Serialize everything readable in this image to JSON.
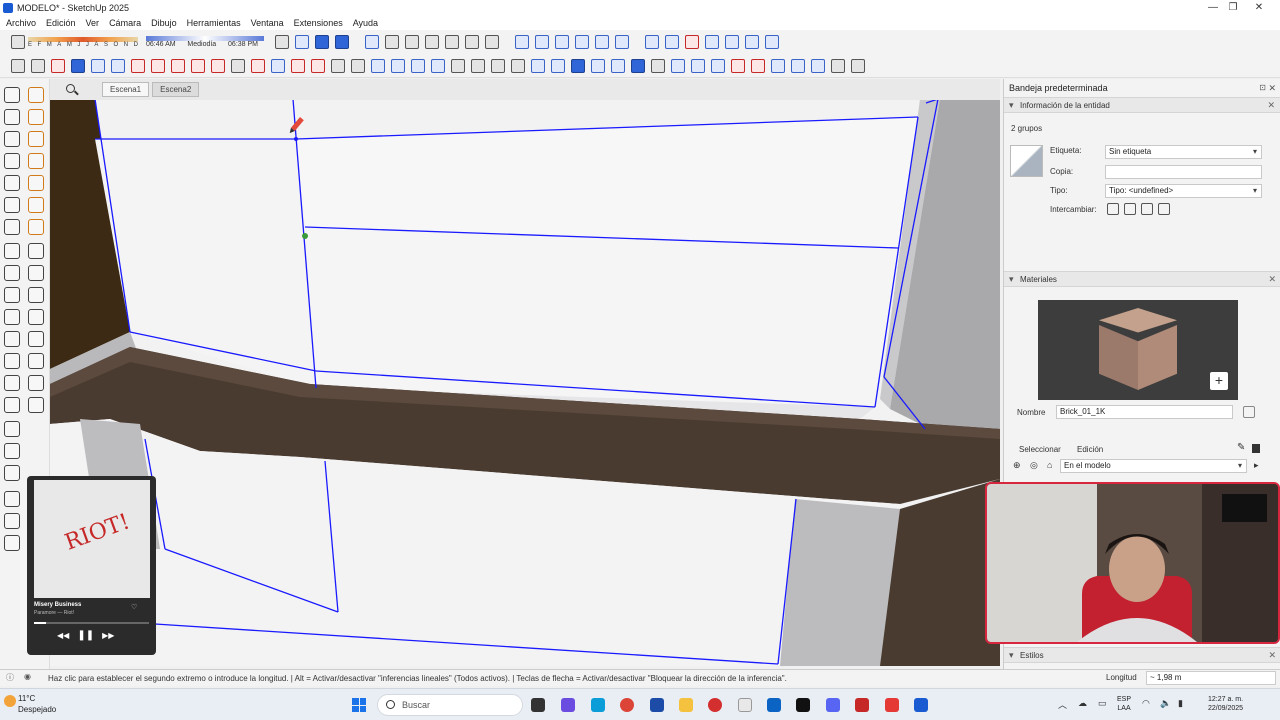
{
  "window": {
    "title": "MODELO* - SketchUp 2025"
  },
  "menu": [
    "Archivo",
    "Edición",
    "Ver",
    "Cámara",
    "Dibujo",
    "Herramientas",
    "Ventana",
    "Extensiones",
    "Ayuda"
  ],
  "shadow": {
    "months": [
      "E",
      "F",
      "M",
      "A",
      "M",
      "J",
      "J",
      "A",
      "S",
      "O",
      "N",
      "D"
    ],
    "time_start": "06:46 AM",
    "mid_label": "Mediodía",
    "time_end": "06:38 PM"
  },
  "scenes": [
    "Escena1",
    "Escena2"
  ],
  "panel": {
    "title": "Bandeja predeterminada",
    "entity_section": "Información de la entidad",
    "selection_count": "2 grupos",
    "label_etiqueta": "Etiqueta:",
    "etiqueta_value": "Sin etiqueta",
    "label_copia": "Copia:",
    "copia_value": "",
    "label_tipo": "Tipo:",
    "tipo_value": "Tipo: <undefined>",
    "label_intercambiar": "Intercambiar:",
    "materials_section": "Materiales",
    "label_nombre": "Nombre",
    "material_name": "Brick_01_1K",
    "tab_select": "Seleccionar",
    "tab_edit": "Edición",
    "in_model": "En el modelo",
    "styles_section": "Estilos"
  },
  "music": {
    "song": "Misery Business",
    "artist": "Paramore — Riot!",
    "art_text": "RIOT!",
    "progress": 0.1
  },
  "status": {
    "message": "Haz clic para establecer el segundo extremo o introduce la longitud.  |  Alt = Activar/desactivar \"inferencias lineales\" (Todos activos).  |  Teclas de flecha = Activar/desactivar \"Bloquear la dirección de la inferencia\".",
    "measure_label": "Longitud",
    "measure_value": "~ 1,98 m"
  },
  "taskbar": {
    "temperature": "11°C",
    "weather": "Despejado",
    "search_placeholder": "Buscar",
    "lang": "ESP",
    "lang2": "LAA",
    "time": "12:27 a. m.",
    "date": "22/09/2025"
  },
  "colors": {
    "accent": "#2f65d6",
    "edge": "#1a1aff",
    "floor": "#4a3b30",
    "webcam_border": "#d8263f"
  }
}
